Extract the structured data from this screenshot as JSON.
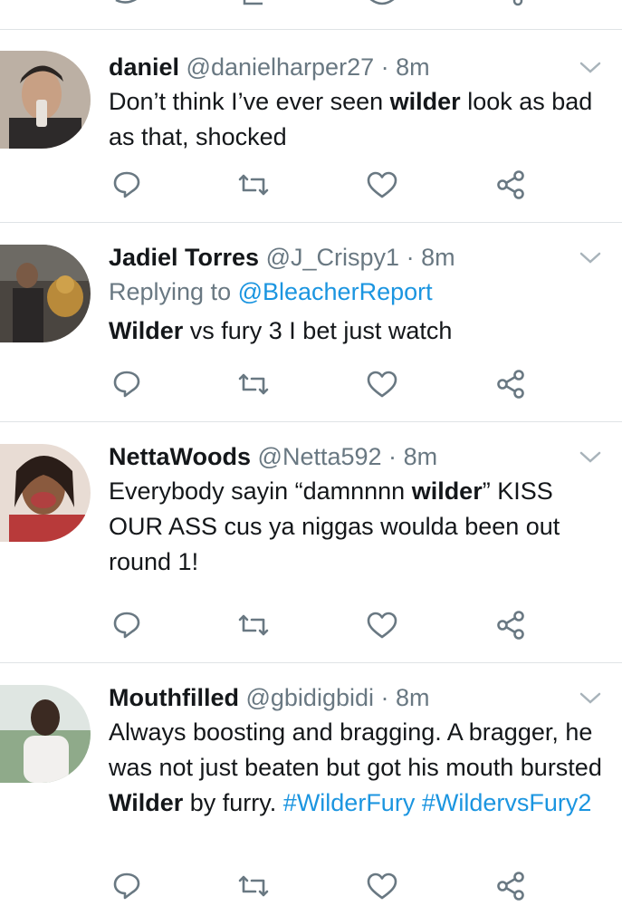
{
  "colors": {
    "text": "#14171a",
    "muted": "#697882",
    "link": "#1b95e0",
    "divider": "#dfe3e6"
  },
  "icons": {
    "reply": "reply-icon",
    "retweet": "retweet-icon",
    "like": "heart-icon",
    "share": "share-icon",
    "more": "chevron-down-icon"
  },
  "tweets": [
    {
      "name": "daniel",
      "handle": "@danielharper27",
      "dot": "·",
      "time": "8m",
      "body": [
        {
          "t": "Don’t think I’ve ever seen "
        },
        {
          "b": "wilder"
        },
        {
          "t": " look as bad as that, shocked"
        }
      ]
    },
    {
      "name": "Jadiel Torres",
      "handle": "@J_Crispy1",
      "dot": "·",
      "time": "8m",
      "reply_prefix": "Replying to ",
      "reply_handle": "@BleacherReport",
      "body": [
        {
          "b": "Wilder"
        },
        {
          "t": " vs fury 3 I bet just watch"
        }
      ]
    },
    {
      "name": "NettaWoods",
      "handle": "@Netta592",
      "dot": "·",
      "time": "8m",
      "body": [
        {
          "t": "Everybody sayin “damnnnn "
        },
        {
          "b": "wilder"
        },
        {
          "t": "” KISS OUR ASS cus ya niggas woulda been out round 1!"
        }
      ]
    },
    {
      "name": "Mouthfilled",
      "handle": "@gbidigbidi",
      "dot": "·",
      "time": "8m",
      "body": [
        {
          "t": "Always boosting and bragging. A bragger, he was not just beaten but got his mouth bursted "
        },
        {
          "b": "Wilder"
        },
        {
          "t": " by furry. "
        },
        {
          "l": "#WilderFury"
        },
        {
          "t": " "
        },
        {
          "l": "#WildervsFury2"
        }
      ]
    }
  ]
}
